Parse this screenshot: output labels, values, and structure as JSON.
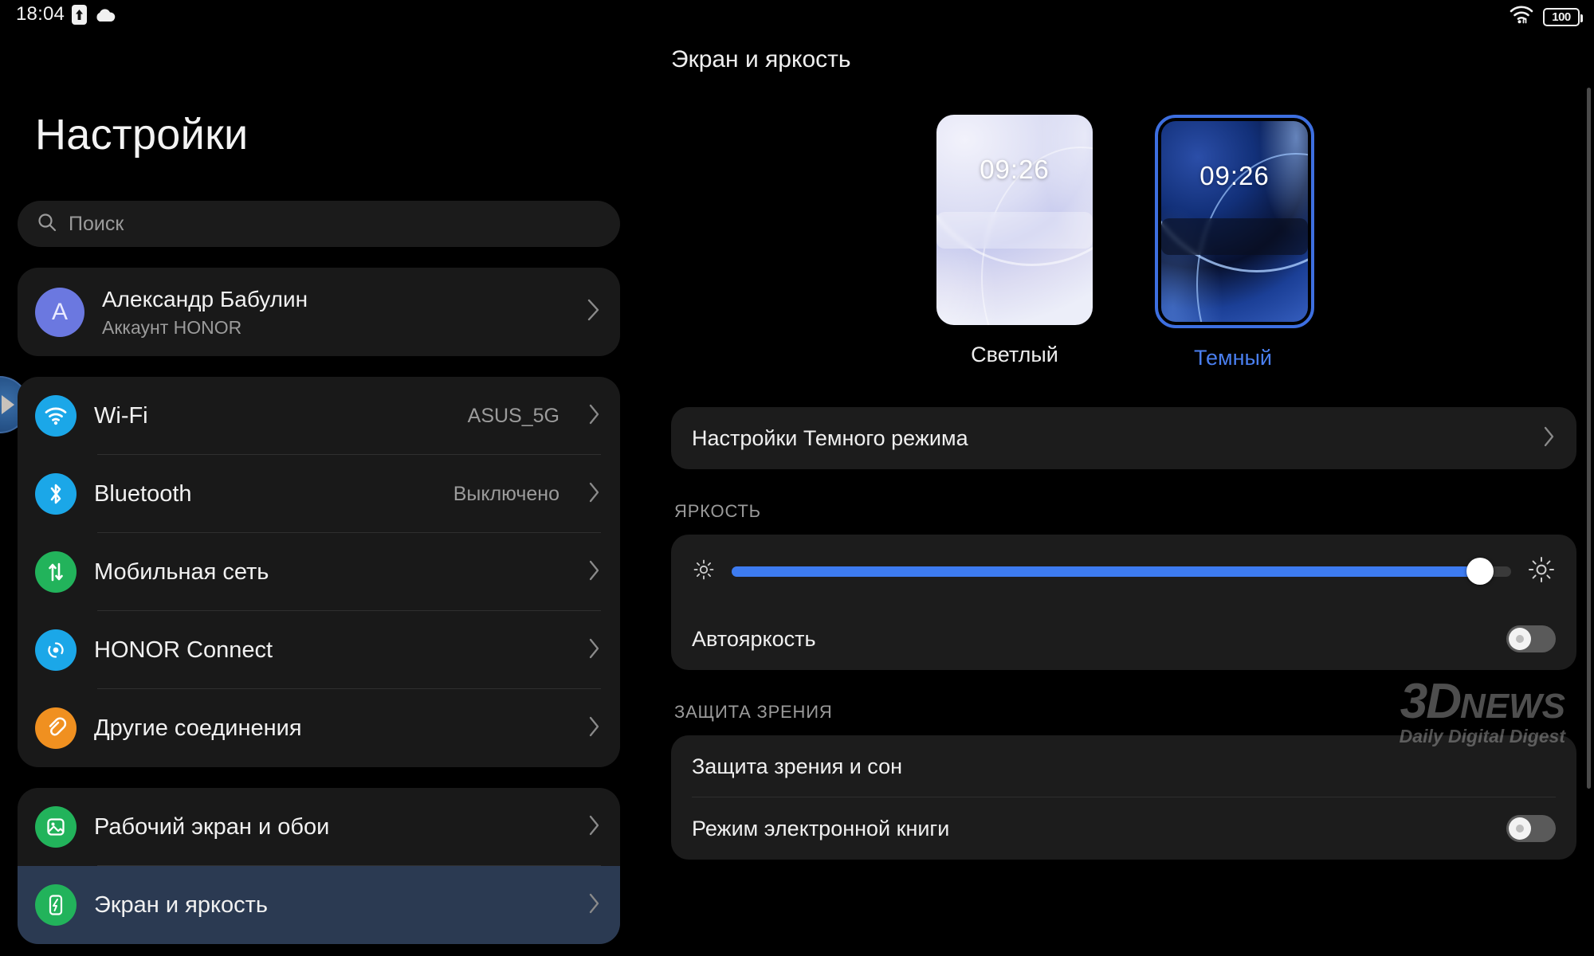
{
  "statusbar": {
    "time": "18:04",
    "upload_icon": "upload-arrow-icon",
    "cloud_icon": "cloud-icon",
    "wifi_icon": "wifi-icon",
    "battery_level": "100"
  },
  "sidebar": {
    "title": "Настройки",
    "search": {
      "placeholder": "Поиск",
      "icon": "search-icon"
    },
    "account": {
      "avatar_letter": "A",
      "name": "Александр Бабулин",
      "subtitle": "Аккаунт HONOR",
      "chevron": "chevron-right-icon",
      "avatar_color": "#6b78e0"
    },
    "groups": [
      {
        "items": [
          {
            "label": "Wi-Fi",
            "value": "ASUS_5G",
            "icon": "wifi-icon",
            "icon_color": "#1ba7e8",
            "selected": false
          },
          {
            "label": "Bluetooth",
            "value": "Выключено",
            "icon": "bluetooth-icon",
            "icon_color": "#1ba7e8",
            "selected": false
          },
          {
            "label": "Мобильная сеть",
            "value": "",
            "icon": "mobile-data-icon",
            "icon_color": "#22b35b",
            "selected": false
          },
          {
            "label": "HONOR Connect",
            "value": "",
            "icon": "honor-connect-icon",
            "icon_color": "#1ba7e8",
            "selected": false
          },
          {
            "label": "Другие соединения",
            "value": "",
            "icon": "link-icon",
            "icon_color": "#f09020",
            "selected": false
          }
        ]
      },
      {
        "items": [
          {
            "label": "Рабочий экран и обои",
            "value": "",
            "icon": "wallpaper-icon",
            "icon_color": "#22b35b",
            "selected": false
          },
          {
            "label": "Экран и яркость",
            "value": "",
            "icon": "display-icon",
            "icon_color": "#22b35b",
            "selected": true
          }
        ]
      }
    ]
  },
  "content": {
    "title": "Экран и яркость",
    "themes": [
      {
        "label": "Светлый",
        "clock": "09:26",
        "selected": false
      },
      {
        "label": "Темный",
        "clock": "09:26",
        "selected": true
      }
    ],
    "dark_mode_row": {
      "label": "Настройки Темного режима",
      "chevron": "chevron-right-icon"
    },
    "brightness": {
      "section": "ЯРКОСТЬ",
      "slider_percent": 96,
      "low_icon": "brightness-low-icon",
      "high_icon": "brightness-high-icon",
      "auto_label": "Автояркость",
      "auto_on": false
    },
    "eye_comfort": {
      "section": "ЗАЩИТА ЗРЕНИЯ",
      "rows": [
        {
          "label": "Защита зрения и сон",
          "type": "chevron"
        },
        {
          "label": "Режим электронной книги",
          "type": "toggle",
          "on": false
        }
      ]
    }
  },
  "watermark": {
    "brand_3d": "3D",
    "brand_news": "NEWS",
    "tagline": "Daily Digital Digest"
  },
  "colors": {
    "accent_blue": "#3d7bf0",
    "selected_row_bg": "#2b3a52",
    "card_bg": "#191919",
    "page_bg": "#000000"
  }
}
